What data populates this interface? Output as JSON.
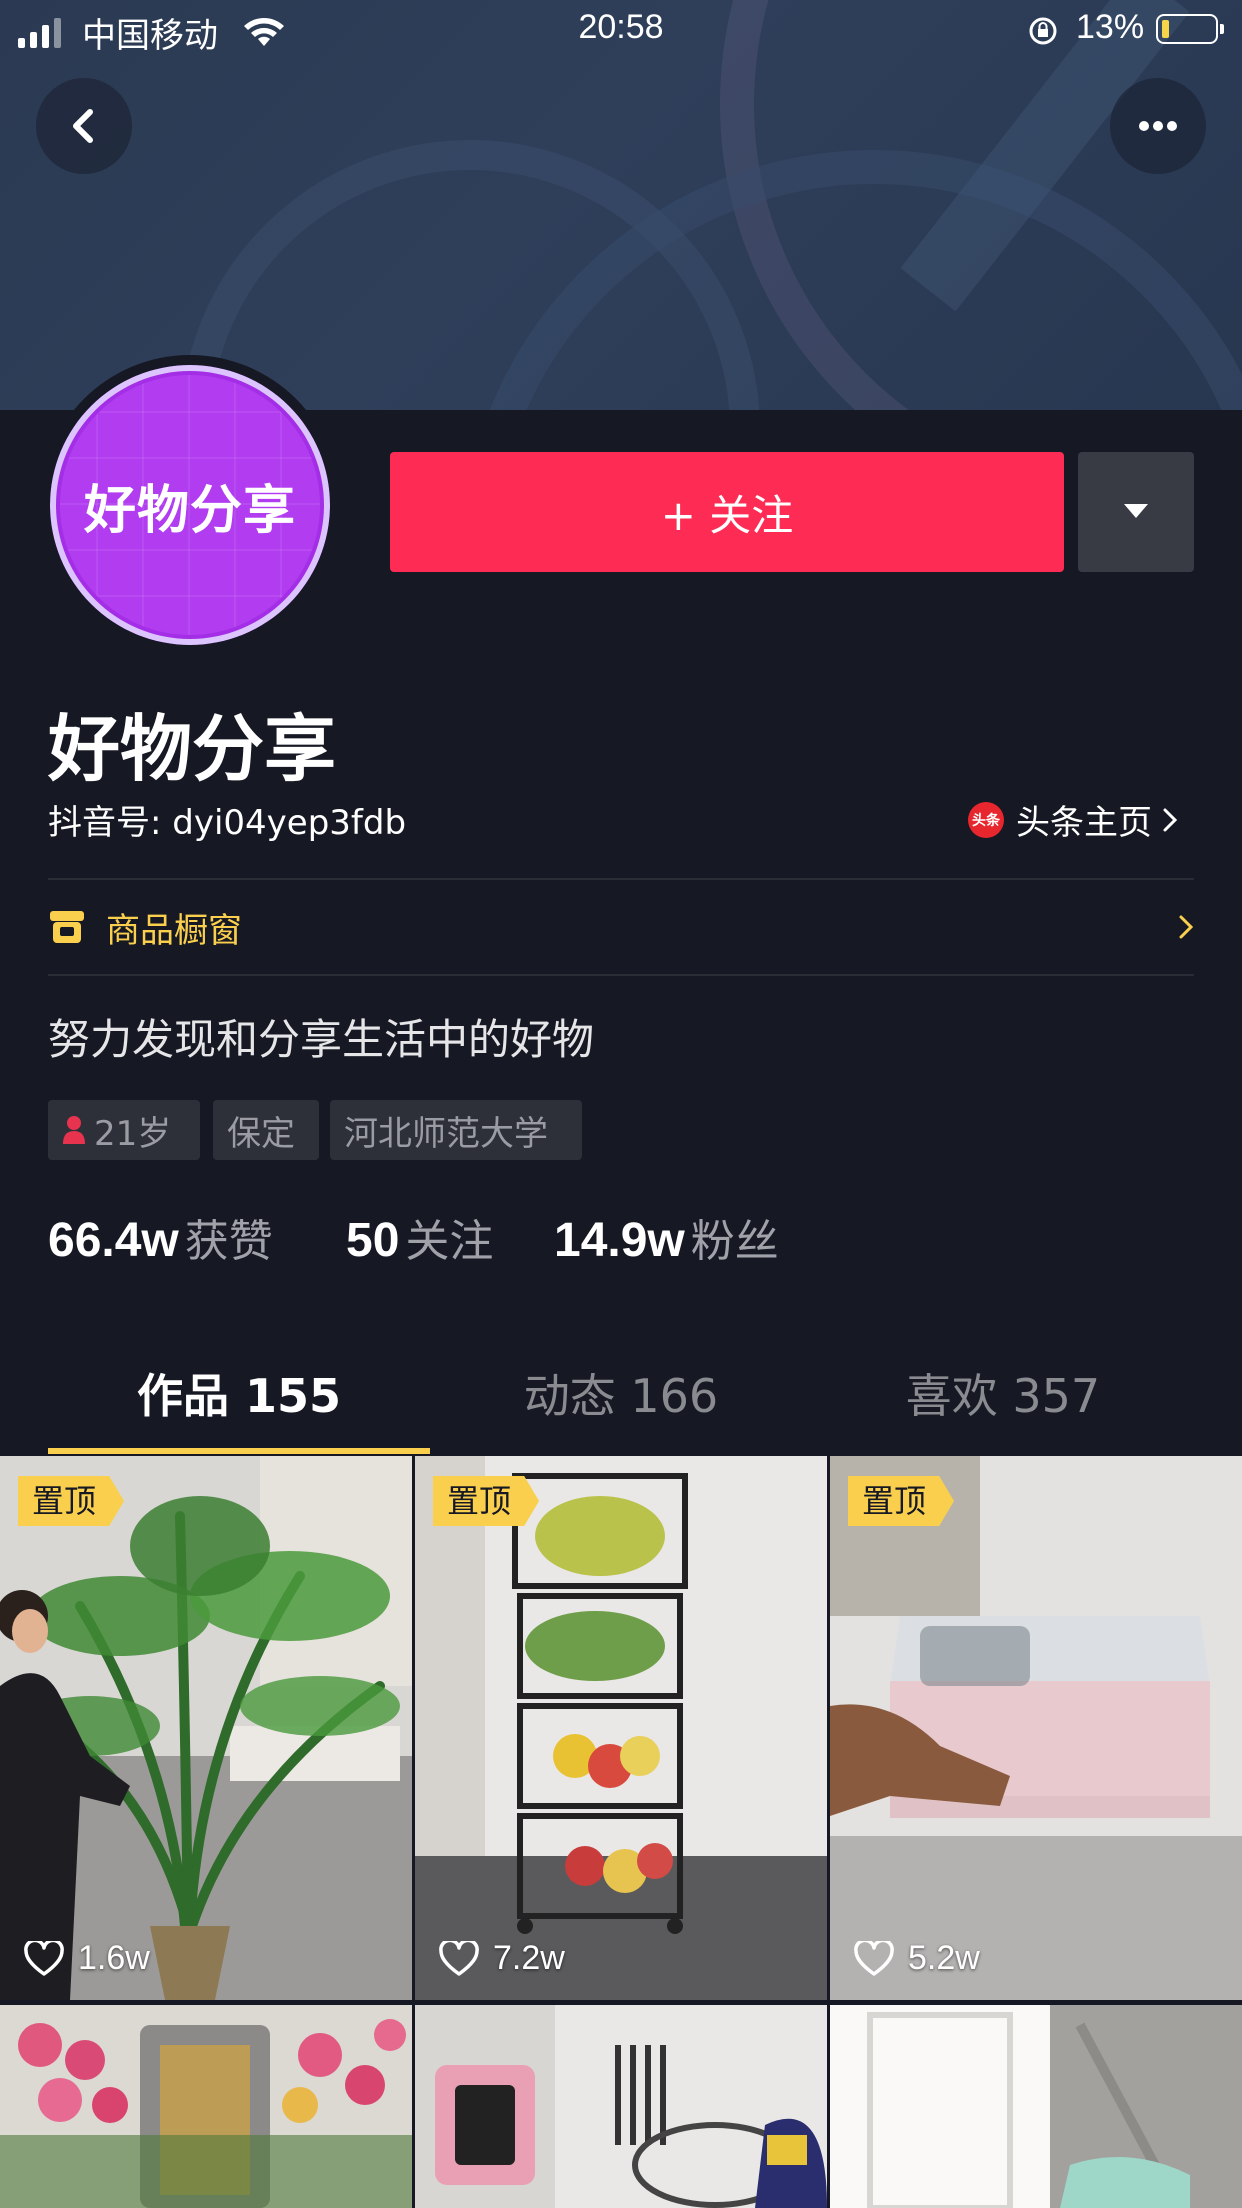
{
  "status_bar": {
    "carrier": "中国移动",
    "time": "20:58",
    "battery_percent": "13%",
    "battery_level": 0.13
  },
  "header": {
    "back_icon": "chevron-left-icon",
    "more_icon": "more-horizontal-icon"
  },
  "profile": {
    "avatar_text": "好物分享",
    "avatar_color": "#b13cf0",
    "follow_label": "+ 关注",
    "follow_color": "#fe2c55",
    "display_name": "好物分享",
    "douyin_id": "抖音号: dyi04yep3fdb",
    "toutiao_logo_text": "头条",
    "toutiao_label": "头条主页",
    "shop_label": "商品橱窗",
    "bio": "努力发现和分享生活中的好物",
    "tags": {
      "age": "21岁",
      "city": "保定",
      "school": "河北师范大学"
    },
    "stats": {
      "likes_value": "66.4w",
      "likes_label": "获赞",
      "following_value": "50",
      "following_label": "关注",
      "fans_value": "14.9w",
      "fans_label": "粉丝"
    }
  },
  "tabs": [
    {
      "label": "作品 155",
      "active": true
    },
    {
      "label": "动态 166",
      "active": false
    },
    {
      "label": "喜欢 357",
      "active": false
    }
  ],
  "accent_color": "#facf4e",
  "videos": [
    {
      "pinned_label": "置顶",
      "likes": "1.6w"
    },
    {
      "pinned_label": "置顶",
      "likes": "7.2w"
    },
    {
      "pinned_label": "置顶",
      "likes": "5.2w"
    },
    {
      "likes": ""
    },
    {
      "likes": ""
    },
    {
      "likes": ""
    }
  ]
}
